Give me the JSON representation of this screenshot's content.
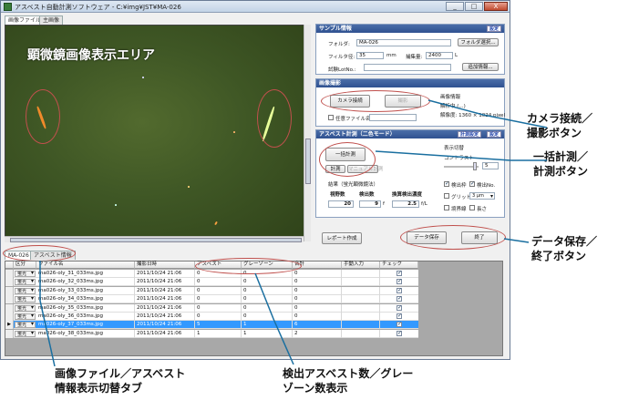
{
  "window": {
    "title": "アスベスト自動計測ソフトウェア - C:¥img¥JST¥MA-026",
    "controls": [
      "_",
      "□",
      "X"
    ]
  },
  "viewer": {
    "tabs": [
      "画像ファイル",
      "主画像"
    ],
    "title": "顕微鏡画像表示エリア"
  },
  "sample": {
    "header": "サンプル情報",
    "settings_link": "設定",
    "folder_label": "フォルダ:",
    "folder_value": "MA-026",
    "folder_button": "フォルダ選択...",
    "filter_label": "フィルタ径:",
    "filter_value": "35",
    "filter_unit": "mm",
    "volume_label": "捕集量:",
    "volume_value": "2400",
    "volume_unit": "L",
    "lot_label": "試験LotNo.:",
    "lot_value": "",
    "add_info_button": "追加情報..."
  },
  "capture": {
    "header": "画像撮影",
    "camera_button": "カメラ接続",
    "shoot_button": "撮影",
    "any_file_label": "任意ファイル名",
    "info_label": "画像情報",
    "info_sub": "解析中 (...)",
    "resolution": "解像度: 1360 × 1024 pixel"
  },
  "measure": {
    "header": "アスベスト計測（二色モード）",
    "calc_link": "計測設定",
    "settings_link": "設定",
    "batch_button": "一括計測",
    "measure_button": "計測",
    "manual_button": "マニュアル計測",
    "display_label": "表示切替",
    "contrast_label": "コントラスト",
    "contrast_value": "5",
    "detect_label": "検出枠",
    "detect_no_label": "検出No.",
    "grid_label": "グリッド",
    "grid_value": "3 μm",
    "boundary_label": "境界線",
    "length_label": "長さ",
    "result_label": "結果（蛍光顕微鏡法）",
    "fields_label": "視野数",
    "fields_value": "20",
    "count_label": "検出数",
    "count_value": "9",
    "count_unit": "f",
    "conc_label": "換算検出濃度",
    "conc_value": "2.5",
    "conc_unit": "f/L"
  },
  "buttons": {
    "report": "レポート作成",
    "save": "データ保存",
    "exit": "終了"
  },
  "bottom_tabs": [
    "MA-026",
    "アスベスト情報"
  ],
  "table": {
    "columns": [
      "区分",
      "ファイル名",
      "撮影日時",
      "アスベスト",
      "グレーゾーン",
      "合計",
      "手動入力",
      "チェック"
    ],
    "rows": [
      {
        "kind": "蛍光",
        "file": "ma026-oly_31_033ms.jpg",
        "date": "2011/10/24 21:06",
        "asb": "0",
        "gray": "0",
        "total": "0"
      },
      {
        "kind": "蛍光",
        "file": "ma026-oly_32_033ms.jpg",
        "date": "2011/10/24 21:06",
        "asb": "0",
        "gray": "0",
        "total": "0"
      },
      {
        "kind": "蛍光",
        "file": "ma026-oly_33_033ms.jpg",
        "date": "2011/10/24 21:06",
        "asb": "0",
        "gray": "0",
        "total": "0"
      },
      {
        "kind": "蛍光",
        "file": "ma026-oly_34_033ms.jpg",
        "date": "2011/10/24 21:06",
        "asb": "0",
        "gray": "0",
        "total": "0"
      },
      {
        "kind": "蛍光",
        "file": "ma026-oly_35_033ms.jpg",
        "date": "2011/10/24 21:06",
        "asb": "0",
        "gray": "0",
        "total": "0"
      },
      {
        "kind": "蛍光",
        "file": "ma026-oly_36_033ms.jpg",
        "date": "2011/10/24 21:06",
        "asb": "0",
        "gray": "0",
        "total": "0"
      },
      {
        "kind": "蛍光",
        "file": "ma026-oly_37_033ms.jpg",
        "date": "2011/10/24 21:06",
        "asb": "5",
        "gray": "1",
        "total": "6"
      },
      {
        "kind": "蛍光",
        "file": "ma026-oly_38_033ms.jpg",
        "date": "2011/10/24 21:06",
        "asb": "1",
        "gray": "1",
        "total": "2"
      }
    ]
  },
  "annotations": {
    "camera": [
      "カメラ接続／",
      "撮影ボタン"
    ],
    "measure": [
      "一括計測／",
      "計測ボタン"
    ],
    "save": [
      "データ保存／",
      "終了ボタン"
    ],
    "tabs": [
      "画像ファイル／アスベスト",
      "情報表示切替タブ"
    ],
    "counts": [
      "検出アスベスト数／グレー",
      "ゾーン数表示"
    ]
  },
  "colors": {
    "accent": "#2f5190",
    "selected_row": "#3399ff",
    "highlight": "#c0504d",
    "callout_line": "#1a6fa0"
  }
}
